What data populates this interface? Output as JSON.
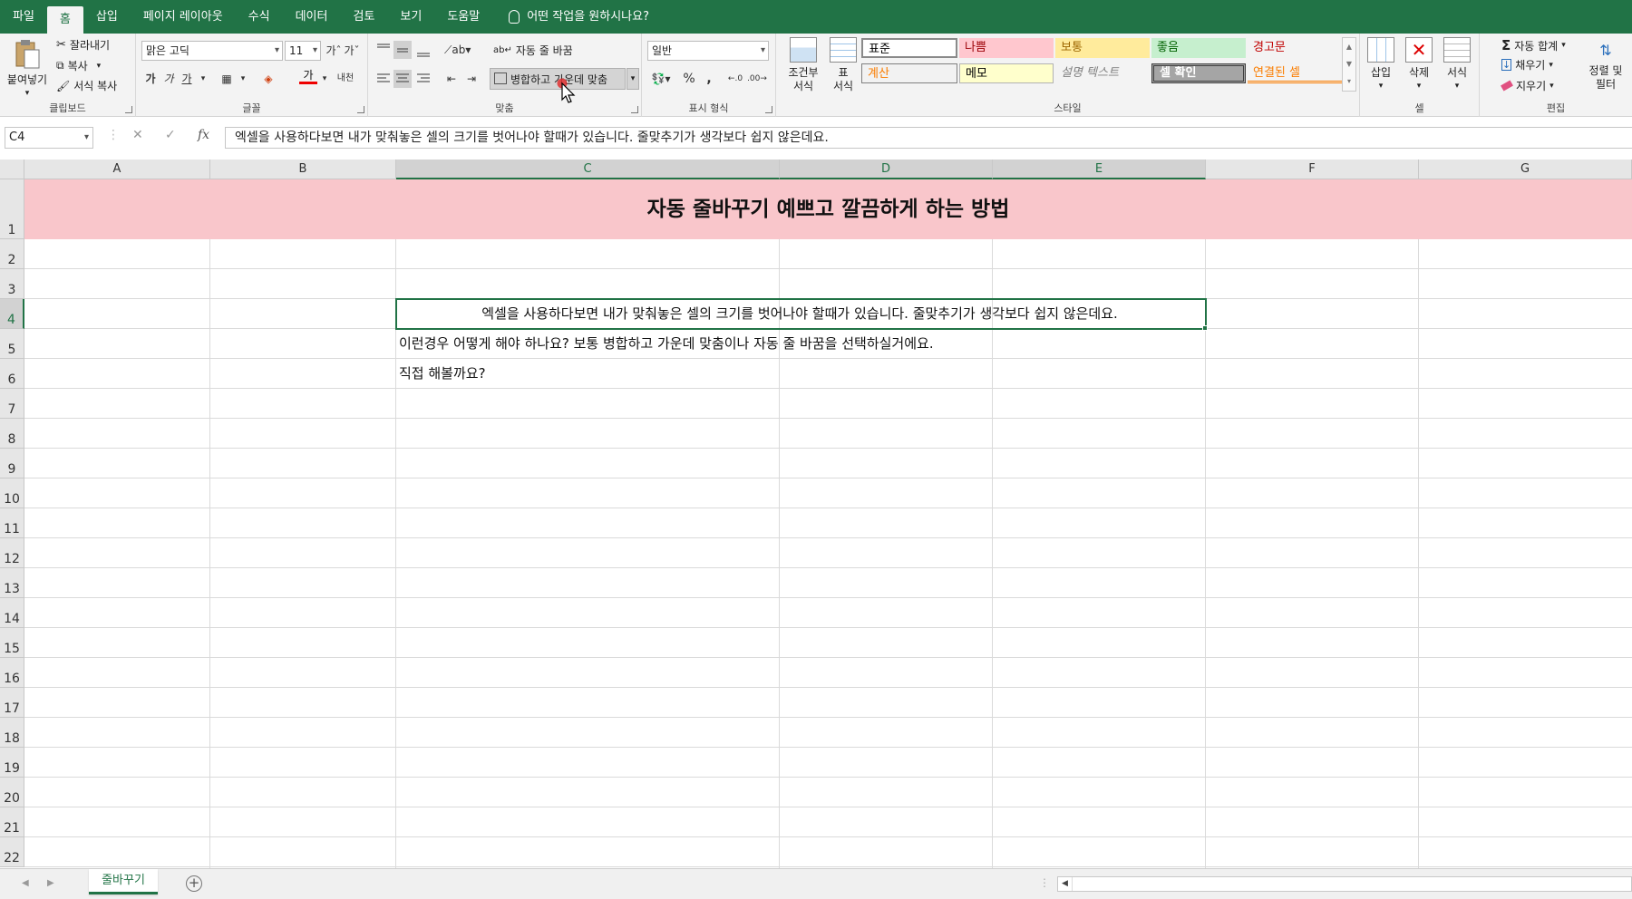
{
  "tabs": [
    "파일",
    "홈",
    "삽입",
    "페이지 레이아웃",
    "수식",
    "데이터",
    "검토",
    "보기",
    "도움말"
  ],
  "tellme": "어떤 작업을 원하시나요?",
  "ribbon": {
    "clipboard": {
      "label": "클립보드",
      "paste": "붙여넣기",
      "cut": "잘라내기",
      "copy": "복사",
      "format_painter": "서식 복사"
    },
    "font": {
      "label": "글꼴",
      "name": "맑은 고딕",
      "size": "11",
      "bold": "가",
      "italic": "가",
      "underline": "가",
      "font_color_glyph": "가",
      "phonetic": "내천"
    },
    "alignment": {
      "label": "맞춤",
      "wrap_text": "자동 줄 바꿈",
      "merge_center": "병합하고 가운데 맞춤"
    },
    "number": {
      "label": "표시 형식",
      "format": "일반",
      "percent": "%",
      "comma": ","
    },
    "styles": {
      "label": "스타일",
      "cond_format": "조건부 서식",
      "table_format": "표 서식",
      "cells": [
        {
          "name": "표준",
          "color": "#ffffff",
          "text": "#000000"
        },
        {
          "name": "나쁨",
          "color": "#ffc7ce",
          "text": "#9c0006"
        },
        {
          "name": "보통",
          "color": "#ffeb9c",
          "text": "#9c6500"
        },
        {
          "name": "좋음",
          "color": "#c6efce",
          "text": "#006100"
        },
        {
          "name": "경고문",
          "color": "#f3f3f3",
          "text": "#c00000"
        },
        {
          "name": "계산",
          "color": "#f2f2f2",
          "text": "#fa7d00"
        },
        {
          "name": "메모",
          "color": "#ffffcc",
          "text": "#000000"
        },
        {
          "name": "설명 텍스트",
          "color": "#f3f3f3",
          "text": "#7f7f7f"
        },
        {
          "name": "셀 확인",
          "color": "#a5a5a5",
          "text": "#ffffff"
        },
        {
          "name": "연결된 셀",
          "color": "#f3f3f3",
          "text": "#fa7d00"
        }
      ]
    },
    "cells": {
      "label": "셀",
      "insert": "삽입",
      "delete": "삭제",
      "format": "서식"
    },
    "editing": {
      "label": "편집",
      "autosum": "자동 합계",
      "fill": "채우기",
      "clear": "지우기",
      "sort_filter_1": "정렬 및",
      "sort_filter_2": "필터"
    }
  },
  "formula_bar": {
    "name_box": "C4",
    "fx": "fx",
    "content": "엑셀을 사용하다보면 내가 맞춰놓은 셀의 크기를 벗어나야 할때가 있습니다. 줄맞추기가 생각보다 쉽지 않은데요."
  },
  "grid": {
    "columns": [
      "A",
      "B",
      "C",
      "D",
      "E",
      "F",
      "G"
    ],
    "rows": [
      "1",
      "2",
      "3",
      "4",
      "5",
      "6",
      "7",
      "8",
      "9",
      "10",
      "11",
      "12",
      "13",
      "14",
      "15",
      "16",
      "17",
      "18",
      "19",
      "20",
      "21",
      "22"
    ],
    "title": "자동 줄바꾸기 예쁘고 깔끔하게 하는 방법",
    "c4": "엑셀을 사용하다보면 내가 맞춰놓은 셀의 크기를 벗어나야 할때가 있습니다. 줄맞추기가 생각보다 쉽지 않은데요.",
    "c5": "이런경우 어떻게 해야 하나요? 보통 병합하고 가운데 맞춤이나 자동 줄 바꿈을 선택하실거에요.",
    "c6": "직접 해볼까요?"
  },
  "sheet": {
    "name": "줄바꾸기"
  },
  "colors": {
    "accent": "#217346",
    "title_fill": "#f9c6cb"
  }
}
